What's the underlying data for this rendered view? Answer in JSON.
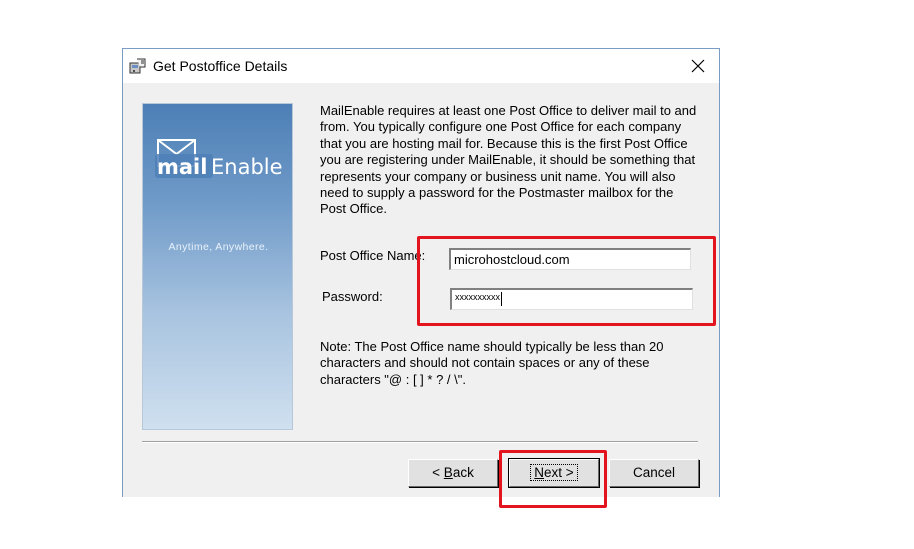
{
  "window": {
    "title": "Get Postoffice Details",
    "icon": "mailenable-setup-icon",
    "close_glyph": "✕"
  },
  "banner": {
    "logo_text_left": "mail",
    "logo_text_right": "Enable",
    "tagline": "Anytime, Anywhere."
  },
  "description": "MailEnable requires at least one Post Office to deliver mail to and from. You typically configure one Post Office for each company that you are hosting mail for. Because this is the first Post Office you are registering under MailEnable, it should be something that represents your company or business unit name. You will also need to supply a password for the Postmaster mailbox for the Post Office.",
  "form": {
    "post_office_name_label": "Post Office Name:",
    "post_office_name_value": "microhostcloud.com",
    "password_label": "Password:",
    "password_value": "xxxxxxxxxx"
  },
  "note": "Note: The Post Office name should typically be less than 20 characters and should not contain spaces or any of these characters \"@ : [ ] * ? / \\\".",
  "buttons": {
    "back_prefix": "< ",
    "back_underlined": "B",
    "back_rest": "ack",
    "next_underlined": "N",
    "next_rest": "ext >",
    "cancel": "Cancel"
  },
  "highlight_color": "#e3141d"
}
